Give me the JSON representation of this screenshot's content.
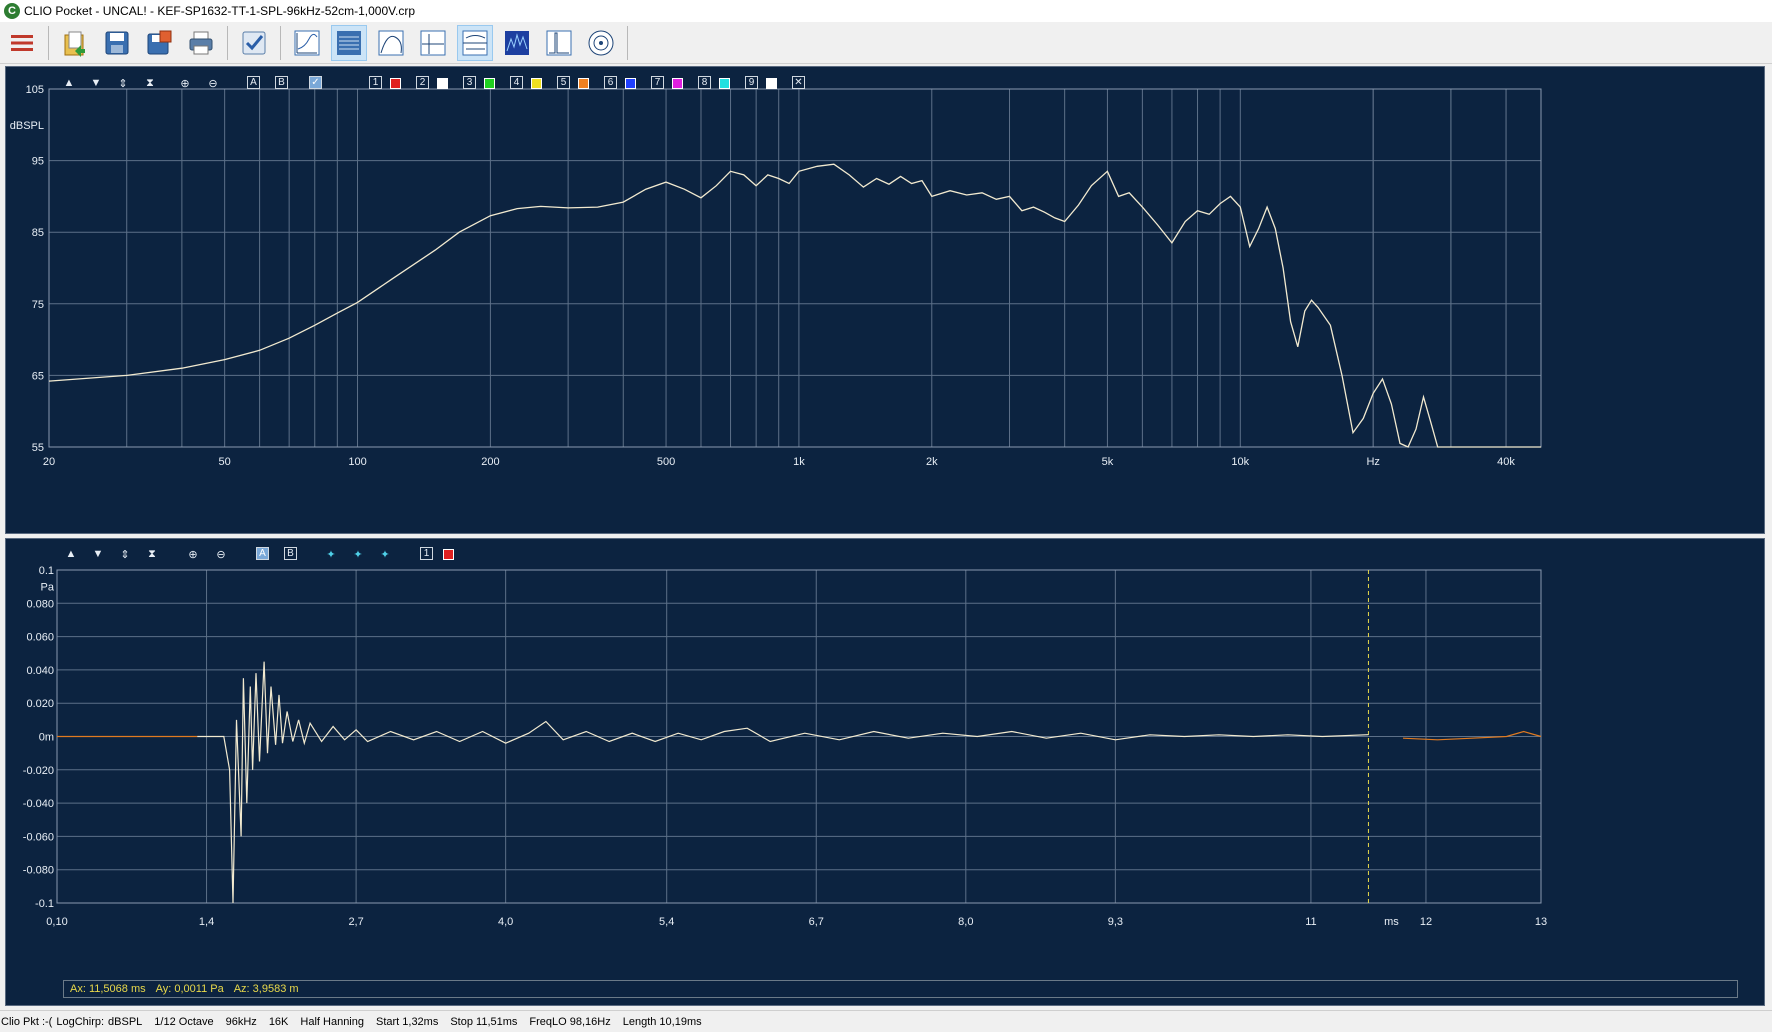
{
  "window": {
    "title": "CLIO Pocket - UNCAL! - KEF-SP1632-TT-1-SPL-96kHz-52cm-1,000V.crp",
    "app_icon": "clio-logo-icon"
  },
  "toolbar": {
    "buttons": [
      {
        "icon": "menu-icon",
        "active": false
      },
      {
        "icon": "open-file-icon",
        "active": false
      },
      {
        "icon": "save-icon",
        "active": false
      },
      {
        "icon": "save-as-icon",
        "active": false
      },
      {
        "icon": "print-icon",
        "active": false
      },
      {
        "icon": "checklist-icon",
        "active": false
      },
      {
        "icon": "frequency-response-icon",
        "active": false
      },
      {
        "icon": "waterfall-icon",
        "active": true
      },
      {
        "icon": "curve-icon",
        "active": false
      },
      {
        "icon": "time-domain-icon",
        "active": false
      },
      {
        "icon": "dual-view-icon",
        "active": true
      },
      {
        "icon": "spectrogram-icon",
        "active": false
      },
      {
        "icon": "impulse-icon",
        "active": false
      },
      {
        "icon": "polar-icon",
        "active": false
      }
    ]
  },
  "freq_panel": {
    "overlays": [
      "1",
      "2",
      "3",
      "4",
      "5",
      "6",
      "7",
      "8",
      "9"
    ],
    "overlay_colors": [
      "#e02020",
      "#ffffff",
      "#20d020",
      "#f0e020",
      "#f08020",
      "#2040ff",
      "#e020e0",
      "#20e0e0",
      "#ffffff"
    ],
    "tool_labels": {
      "a": "A",
      "b": "B"
    }
  },
  "time_panel": {
    "tool_labels": {
      "a": "A",
      "b": "B",
      "overlay": "1"
    }
  },
  "cursor_readout": {
    "ax": "Ax: 11,5068 ms",
    "ay": "Ay: 0,0011 Pa",
    "az": "Az: 3,9583 m"
  },
  "status": {
    "app": "Clio Pkt :-(",
    "signal": "LogChirp:",
    "units": "dBSPL",
    "smoothing": "1/12 Octave",
    "sample_rate": "96kHz",
    "size": "16K",
    "window": "Half Hanning",
    "start": "Start 1,32ms",
    "stop": "Stop 11,51ms",
    "freq_lo": "FreqLO 98,16Hz",
    "length": "Length 10,19ms"
  },
  "chart_data": [
    {
      "type": "line",
      "ylabel": "dBSPL",
      "xlabel": "Hz",
      "x_scale": "log",
      "xlim": [
        20,
        48000
      ],
      "ylim": [
        55,
        105
      ],
      "x_ticks": [
        20,
        50,
        100,
        200,
        500,
        1000,
        2000,
        5000,
        10000,
        40000
      ],
      "x_tick_labels": [
        "20",
        "50",
        "100",
        "200",
        "500",
        "1k",
        "2k",
        "5k",
        "10k",
        "40k"
      ],
      "y_ticks": [
        55,
        65,
        75,
        85,
        95,
        105
      ],
      "grid": true,
      "line_color": "#f2ead0",
      "series": [
        {
          "x": [
            20,
            30,
            40,
            50,
            60,
            70,
            80,
            90,
            100,
            120,
            150,
            170,
            200,
            230,
            260,
            300,
            350,
            400,
            450,
            500,
            550,
            600,
            650,
            700,
            750,
            800,
            850,
            900,
            950,
            1000,
            1100,
            1200,
            1300,
            1400,
            1500,
            1600,
            1700,
            1800,
            1900,
            2000,
            2200,
            2400,
            2600,
            2800,
            3000,
            3200,
            3400,
            3600,
            3800,
            4000,
            4300,
            4600,
            5000,
            5300,
            5600,
            6000,
            6500,
            7000,
            7500,
            8000,
            8500,
            9000,
            9500,
            10000,
            10500,
            11000,
            11500,
            12000,
            12500,
            13000,
            13500,
            14000,
            14500,
            15000,
            16000,
            17000,
            18000,
            19000,
            20000,
            21000,
            22000,
            23000,
            24000,
            25000,
            26000,
            27000,
            28000,
            29000,
            30000,
            32000,
            35000,
            40000,
            48000
          ],
          "y": [
            64.2,
            65.0,
            66.0,
            67.2,
            68.5,
            70.2,
            72.0,
            73.7,
            75.2,
            78.5,
            82.5,
            85.0,
            87.3,
            88.3,
            88.6,
            88.4,
            88.5,
            89.2,
            91.0,
            92.0,
            91.0,
            89.8,
            91.5,
            93.5,
            93.0,
            91.5,
            93.0,
            92.5,
            91.8,
            93.5,
            94.2,
            94.5,
            93.0,
            91.3,
            92.5,
            91.7,
            92.8,
            91.8,
            92.2,
            90.0,
            90.8,
            90.2,
            90.5,
            89.6,
            90.0,
            88.0,
            88.5,
            87.8,
            87.0,
            86.5,
            88.8,
            91.5,
            93.5,
            90.0,
            90.5,
            88.5,
            86.0,
            83.5,
            86.5,
            88.0,
            87.5,
            89.0,
            90.0,
            88.5,
            83.0,
            85.5,
            88.5,
            85.5,
            80.0,
            72.5,
            69.0,
            74.0,
            75.5,
            74.5,
            72.0,
            65.0,
            57.0,
            59.0,
            62.5,
            64.5,
            61.0,
            55.5,
            55.0,
            57.5,
            62.0,
            58.5,
            55.0,
            55.0,
            55.0,
            55.0,
            55.0,
            55.0,
            55.0
          ]
        }
      ]
    },
    {
      "type": "line",
      "ylabel": "Pa",
      "xlabel": "ms",
      "xlim": [
        0.1,
        13
      ],
      "ylim": [
        -0.1,
        0.1
      ],
      "x_ticks": [
        0.1,
        1.4,
        2.7,
        4.0,
        5.4,
        6.7,
        8.0,
        9.3,
        11,
        12,
        13
      ],
      "x_tick_labels": [
        "0,10",
        "1,4",
        "2,7",
        "4,0",
        "5,4",
        "6,7",
        "8,0",
        "9,3",
        "11",
        "12",
        "13"
      ],
      "y_ticks": [
        0.1,
        0.08,
        0.06,
        0.04,
        0.02,
        0,
        -0.02,
        -0.04,
        -0.06,
        -0.08,
        -0.1
      ],
      "y_tick_labels": [
        "0.1",
        "0.080",
        "0.060",
        "0.040",
        "0.020",
        "0m",
        "-0.020",
        "-0.040",
        "-0.060",
        "-0.080",
        "-0.1"
      ],
      "grid": true,
      "cursor_x_ms": 11.5,
      "window_start_ms": 1.32,
      "window_stop_ms": 11.51,
      "inside_color": "#f2ead0",
      "outside_color": "#e07a20",
      "series": [
        {
          "x": [
            0.1,
            0.5,
            1.0,
            1.2,
            1.32,
            1.45,
            1.55,
            1.6,
            1.63,
            1.66,
            1.7,
            1.72,
            1.75,
            1.78,
            1.8,
            1.83,
            1.86,
            1.9,
            1.93,
            1.96,
            2.0,
            2.03,
            2.06,
            2.1,
            2.15,
            2.2,
            2.25,
            2.3,
            2.4,
            2.5,
            2.6,
            2.7,
            2.8,
            3.0,
            3.2,
            3.4,
            3.6,
            3.8,
            4.0,
            4.2,
            4.35,
            4.5,
            4.7,
            4.9,
            5.1,
            5.3,
            5.5,
            5.7,
            5.9,
            6.1,
            6.3,
            6.6,
            6.9,
            7.2,
            7.5,
            7.8,
            8.1,
            8.4,
            8.7,
            9.0,
            9.3,
            9.6,
            9.9,
            10.2,
            10.5,
            10.8,
            11.1,
            11.5,
            11.8,
            12.1,
            12.4,
            12.7,
            12.85,
            13
          ],
          "y": [
            0,
            0,
            0,
            0,
            0,
            0,
            0,
            -0.02,
            -0.1,
            0.01,
            -0.06,
            0.035,
            -0.04,
            0.03,
            -0.02,
            0.038,
            -0.015,
            0.045,
            -0.01,
            0.03,
            -0.005,
            0.025,
            -0.004,
            0.015,
            -0.003,
            0.01,
            -0.004,
            0.008,
            -0.003,
            0.006,
            -0.002,
            0.004,
            -0.003,
            0.003,
            -0.002,
            0.003,
            -0.003,
            0.003,
            -0.004,
            0.002,
            0.009,
            -0.002,
            0.003,
            -0.003,
            0.002,
            -0.003,
            0.002,
            -0.002,
            0.003,
            0.005,
            -0.003,
            0.002,
            -0.002,
            0.003,
            -0.001,
            0.002,
            0.0,
            0.003,
            -0.001,
            0.002,
            -0.002,
            0.001,
            0.0,
            0.001,
            0.0,
            0.001,
            0.0,
            0.0011,
            -0.001,
            -0.002,
            -0.001,
            0.0,
            0.003,
            0.0
          ]
        }
      ]
    }
  ]
}
